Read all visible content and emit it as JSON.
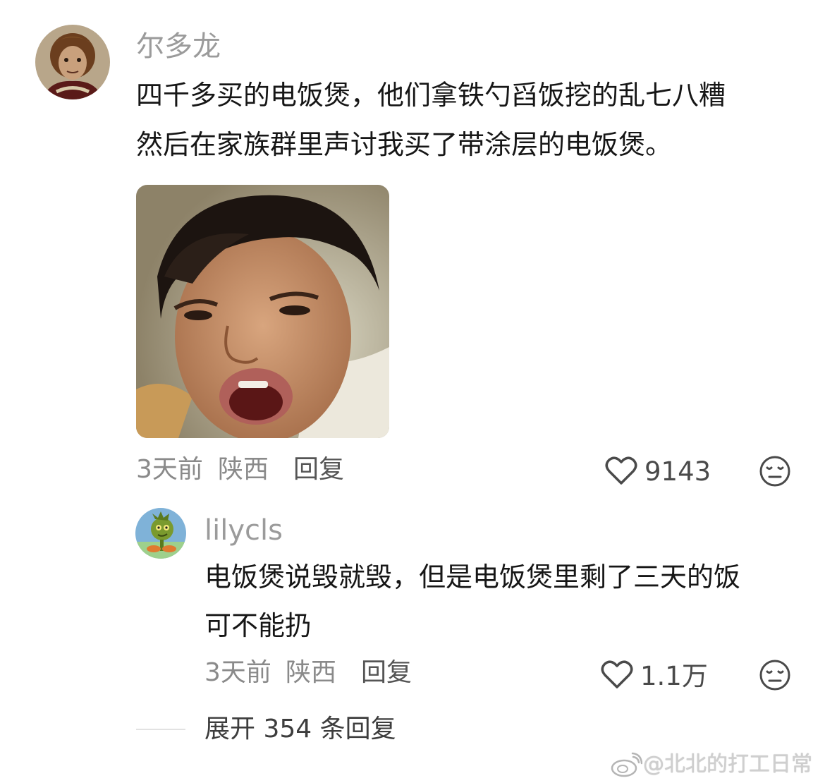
{
  "comment": {
    "username": "尔多龙",
    "text_line1": "四千多买的电饭煲，他们拿铁勺舀饭挖的乱七八糟",
    "text_line2": "然后在家族群里声讨我买了带涂层的电饭煲。",
    "time": "3天前",
    "location": "陕西",
    "reply_label": "回复",
    "like_count": "9143"
  },
  "reply": {
    "username": "lilycls",
    "text_line1": "电饭煲说毁就毁，但是电饭煲里剩了三天的饭",
    "text_line2": "可不能扔",
    "time": "3天前",
    "location": "陕西",
    "reply_label": "回复",
    "like_count": "1.1万"
  },
  "expand_replies": {
    "label": "展开 354 条回复"
  },
  "watermark": {
    "text": "@北北的打工日常"
  },
  "icons": {
    "like": "heart-outline-icon",
    "reaction": "neutral-face-icon",
    "watermark": "weibo-logo-icon"
  }
}
